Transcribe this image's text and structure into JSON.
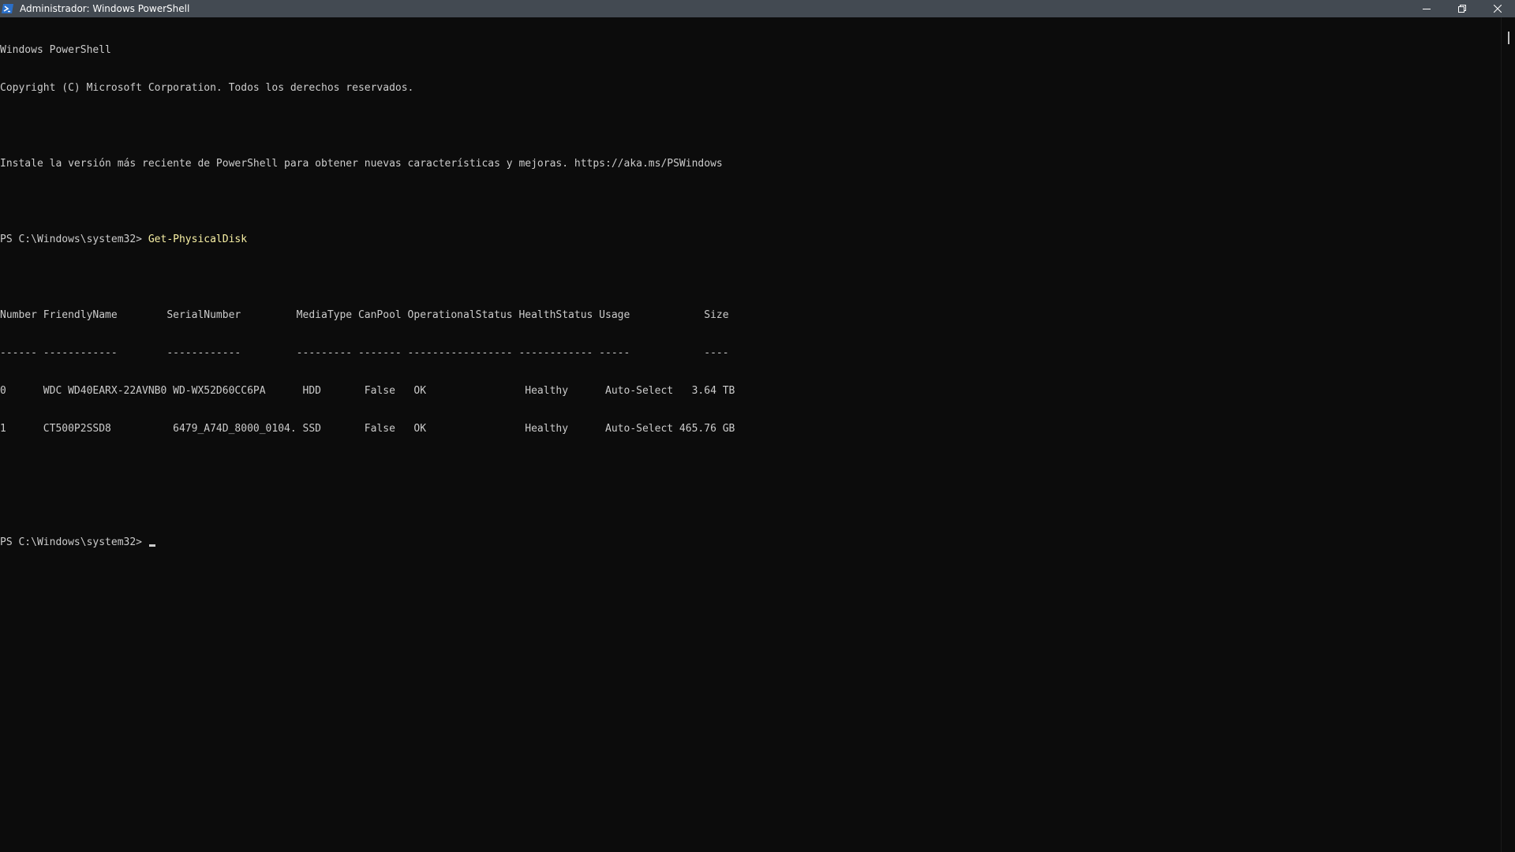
{
  "window": {
    "title": "Administrador: Windows PowerShell",
    "icon": "powershell-icon",
    "controls": [
      "minimize-icon",
      "restore-icon",
      "close-icon"
    ]
  },
  "console": {
    "banner_line1": "Windows PowerShell",
    "banner_line2": "Copyright (C) Microsoft Corporation. Todos los derechos reservados.",
    "banner_line3": "Instale la versión más reciente de PowerShell para obtener nuevas características y mejoras. https://aka.ms/PSWindows",
    "prompt": "PS C:\\Windows\\system32> ",
    "command": "Get-PhysicalDisk",
    "table_header": "Number FriendlyName        SerialNumber         MediaType CanPool OperationalStatus HealthStatus Usage            Size",
    "table_separator": "------ ------------        ------------         --------- ------- ----------------- ------------ -----            ----",
    "row1": "0      WDC WD40EARX-22AVNB0 WD-WX52D60CC6PA      HDD       False   OK                Healthy      Auto-Select   3.64 TB",
    "row2": "1      CT500P2SSD8          6479_A74D_8000_0104. SSD       False   OK                Healthy      Auto-Select 465.76 GB",
    "prompt2": "PS C:\\Windows\\system32> "
  },
  "colors": {
    "background": "#0c0c0c",
    "text": "#cccccc",
    "command": "#f9f1a5",
    "titlebar": "#434a52"
  }
}
